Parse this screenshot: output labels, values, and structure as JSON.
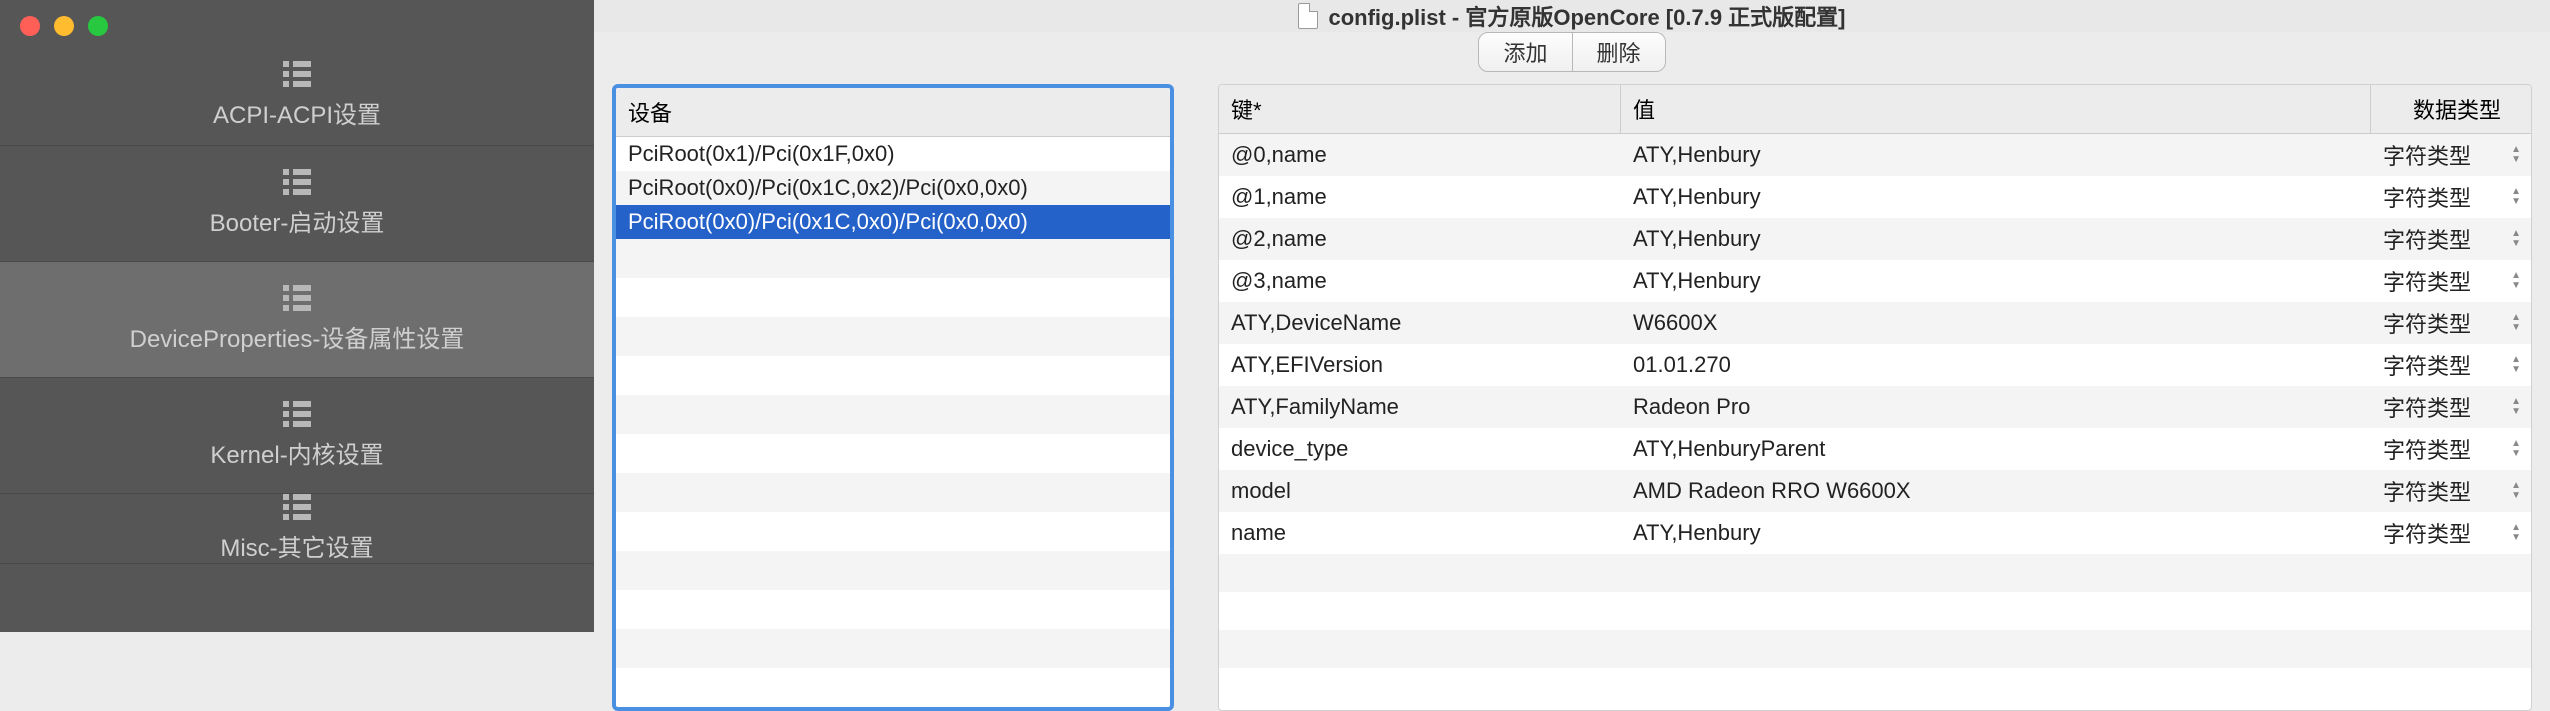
{
  "window": {
    "title": "config.plist - 官方原版OpenCore [0.7.9 正式版配置]"
  },
  "sidebar": {
    "items": [
      {
        "label": "ACPI-ACPI设置"
      },
      {
        "label": "Booter-启动设置"
      },
      {
        "label": "DeviceProperties-设备属性设置"
      },
      {
        "label": "Kernel-内核设置"
      },
      {
        "label": "Misc-其它设置"
      }
    ]
  },
  "toolbar": {
    "add_label": "添加",
    "delete_label": "删除"
  },
  "device_list": {
    "header": "设备",
    "items": [
      "PciRoot(0x1)/Pci(0x1F,0x0)",
      "PciRoot(0x0)/Pci(0x1C,0x2)/Pci(0x0,0x0)",
      "PciRoot(0x0)/Pci(0x1C,0x0)/Pci(0x0,0x0)"
    ],
    "selected_index": 2
  },
  "properties": {
    "headers": {
      "key": "键*",
      "value": "值",
      "type": "数据类型"
    },
    "rows": [
      {
        "key": "@0,name",
        "value": "ATY,Henbury",
        "type": "字符类型"
      },
      {
        "key": "@1,name",
        "value": "ATY,Henbury",
        "type": "字符类型"
      },
      {
        "key": "@2,name",
        "value": "ATY,Henbury",
        "type": "字符类型"
      },
      {
        "key": "@3,name",
        "value": "ATY,Henbury",
        "type": "字符类型"
      },
      {
        "key": "ATY,DeviceName",
        "value": "W6600X",
        "type": "字符类型"
      },
      {
        "key": "ATY,EFIVersion",
        "value": "01.01.270",
        "type": "字符类型"
      },
      {
        "key": "ATY,FamilyName",
        "value": "Radeon Pro",
        "type": "字符类型"
      },
      {
        "key": "device_type",
        "value": "ATY,HenburyParent",
        "type": "字符类型"
      },
      {
        "key": "model",
        "value": "AMD Radeon RRO W6600X",
        "type": "字符类型"
      },
      {
        "key": "name",
        "value": "ATY,Henbury",
        "type": "字符类型"
      }
    ]
  }
}
